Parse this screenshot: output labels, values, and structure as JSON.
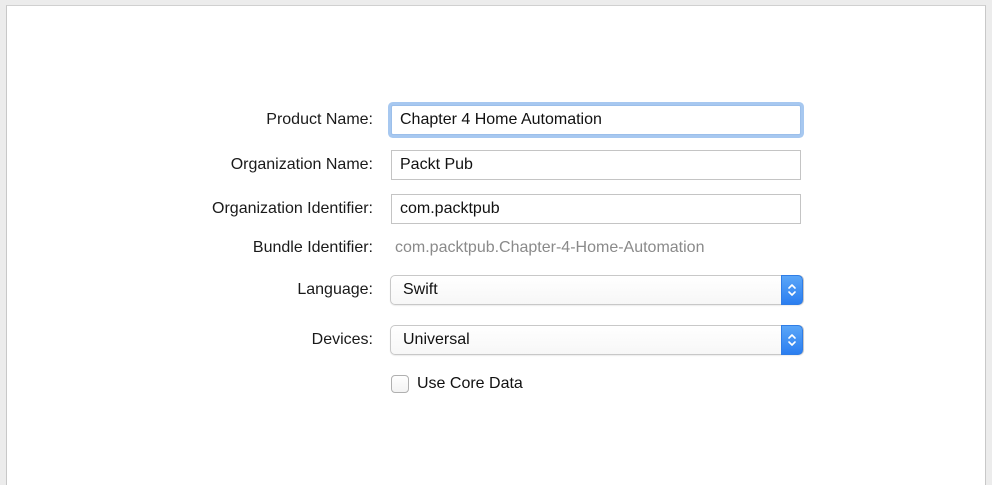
{
  "form": {
    "product_name": {
      "label": "Product Name:",
      "value": "Chapter 4 Home Automation"
    },
    "organization_name": {
      "label": "Organization Name:",
      "value": "Packt Pub"
    },
    "organization_identifier": {
      "label": "Organization Identifier:",
      "value": "com.packtpub"
    },
    "bundle_identifier": {
      "label": "Bundle Identifier:",
      "value": "com.packtpub.Chapter-4-Home-Automation"
    },
    "language": {
      "label": "Language:",
      "selected": "Swift"
    },
    "devices": {
      "label": "Devices:",
      "selected": "Universal"
    },
    "use_core_data": {
      "label": "Use Core Data",
      "checked": false
    }
  },
  "colors": {
    "focus_ring": "#a7c8f0",
    "stepper_blue": "#2b7ef0",
    "static_value_gray": "#8a8a8a"
  },
  "icons": {
    "popup_stepper": "up-down-chevron-icon"
  }
}
